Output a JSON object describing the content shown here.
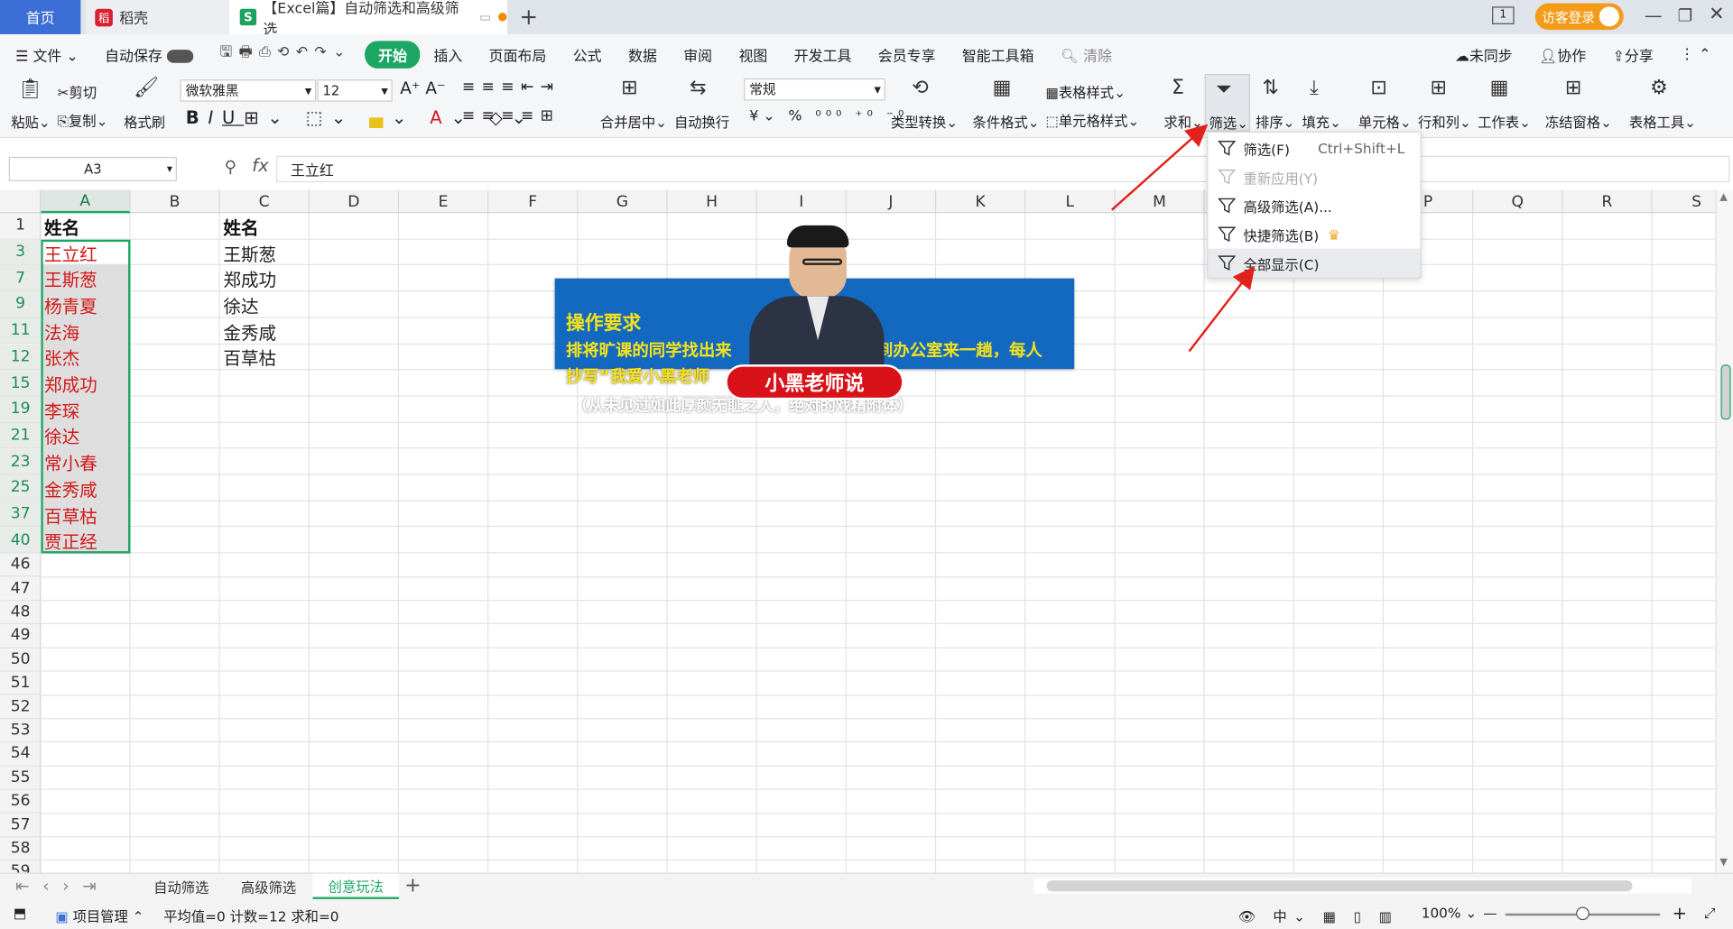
{
  "tabs": {
    "home": "首页",
    "daoke": "稻壳",
    "doc": "【Excel篇】自动筛选和高级筛选"
  },
  "titlebar": {
    "visitor": "访客登录",
    "tab_count": "1"
  },
  "menu": {
    "file": "文件",
    "autosave": "自动保存",
    "start": "开始",
    "items": [
      "插入",
      "页面布局",
      "公式",
      "数据",
      "审阅",
      "视图",
      "开发工具",
      "会员专享",
      "智能工具箱"
    ],
    "clear": "清除",
    "sync": "未同步",
    "collab": "协作",
    "share": "分享"
  },
  "ribbon": {
    "paste": "粘贴",
    "cut": "剪切",
    "copy": "复制",
    "format_painter": "格式刷",
    "font": "微软雅黑",
    "font_size": "12",
    "merge": "合并居中",
    "wrap": "自动换行",
    "number_format": "常规",
    "convert": "类型转换",
    "cond_format": "条件格式",
    "table_style": "表格样式",
    "cell_style": "单元格样式",
    "sum": "求和",
    "filter": "筛选",
    "sort": "排序",
    "fill": "填充",
    "cell": "单元格",
    "rowcol": "行和列",
    "sheet": "工作表",
    "freeze": "冻结窗格",
    "tools": "表格工具"
  },
  "namebox": "A3",
  "formula": "王立红",
  "fx": "fx",
  "columns": [
    "A",
    "B",
    "C",
    "D",
    "E",
    "F",
    "G",
    "H",
    "I",
    "J",
    "K",
    "L",
    "M",
    "N",
    "O",
    "P",
    "Q",
    "R",
    "S"
  ],
  "rows": [
    "1",
    "3",
    "7",
    "9",
    "11",
    "12",
    "15",
    "19",
    "21",
    "23",
    "25",
    "37",
    "40",
    "46",
    "47",
    "48",
    "49",
    "50",
    "51",
    "52",
    "53",
    "54",
    "55",
    "56",
    "57",
    "58",
    "59"
  ],
  "colA": [
    "姓名",
    "王立红",
    "王斯葱",
    "杨青夏",
    "法海",
    "张杰",
    "郑成功",
    "李琛",
    "徐达",
    "常小春",
    "金秀咸",
    "百草枯",
    "贾正经"
  ],
  "colC": [
    "姓名",
    "王斯葱",
    "郑成功",
    "徐达",
    "金秀咸",
    "百草枯"
  ],
  "dropdown": {
    "filter": "筛选(F)",
    "shortcut": "Ctrl+Shift+L",
    "reapply": "重新应用(Y)",
    "advanced": "高级筛选(A)...",
    "quick": "快捷筛选(B)",
    "showall": "全部显示(C)"
  },
  "banner": {
    "title": "操作要求",
    "line1a": "排将旷课的同学找出来",
    "line1b": "课到办公室来一趟，每人",
    "line2": "抄写“我爱小黑老师",
    "line3": "（从未见过如此厚颜无耻之人，绝对的戏精附体）",
    "badge": "小黑老师说"
  },
  "sheets": [
    "自动筛选",
    "高级筛选",
    "创意玩法"
  ],
  "status": {
    "project": "项目管理",
    "stats": "平均值=0  计数=12  求和=0",
    "zoom": "100%"
  },
  "colors": {
    "accent_green": "#1ea664",
    "tab_blue": "#3b6fd6",
    "banner_blue": "#1369bf",
    "red_text": "#d31919",
    "arrow_red": "#e3211b"
  }
}
